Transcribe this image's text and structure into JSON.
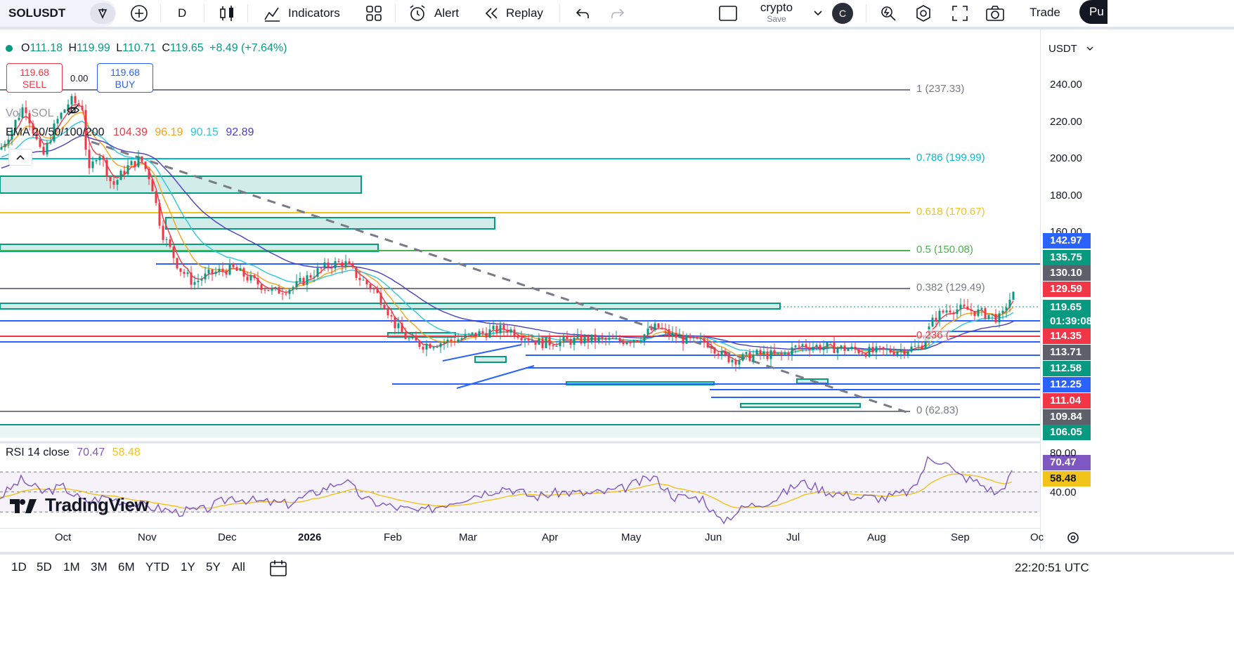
{
  "toolbar": {
    "symbol": "SOLUSDT",
    "interval": "D",
    "indicators_label": "Indicators",
    "alert_label": "Alert",
    "replay_label": "Replay",
    "layout_name": "crypto",
    "layout_save": "Save",
    "avatar_letter": "C",
    "trade_label": "Trade",
    "publish_label": "Pu"
  },
  "ohlc": {
    "open_label": "O",
    "open": "111.18",
    "high_label": "H",
    "high": "119.99",
    "low_label": "L",
    "low": "110.71",
    "close_label": "C",
    "close": "119.65",
    "change": "+8.49 (+7.64%)"
  },
  "trade_buttons": {
    "sell_price": "119.68",
    "sell_label": "SELL",
    "spread": "0.00",
    "buy_price": "119.68",
    "buy_label": "BUY"
  },
  "vol_label": "Vol · SOL",
  "ema": {
    "label": "EMA 20/50/100/200",
    "values": [
      "104.39",
      "96.19",
      "90.15",
      "92.89"
    ],
    "colors": [
      "#f23645",
      "#f7a21b",
      "#2ec7d6",
      "#4a3fbf"
    ]
  },
  "rsi": {
    "label": "RSI 14 close",
    "value": "70.47",
    "ma": "58.48",
    "levels": [
      "80.00",
      "40.00"
    ]
  },
  "currency": "USDT",
  "colors": {
    "up": "#089981",
    "down": "#f23645",
    "zone_fill": "#b2dfdb",
    "zone_border": "#089981",
    "blue_line": "#2962ff",
    "fib_gray": "#787b86",
    "fib_cyan": "#00bcd4",
    "fib_yellow": "#f2c31b",
    "fib_green": "#4caf50",
    "fib_red": "#f23645",
    "rsi_line": "#7e57c2",
    "rsi_ma": "#f2c31b"
  },
  "chart_data": {
    "type": "candlestick",
    "symbol": "SOLUSDT",
    "interval": "D",
    "x_ticks": [
      "Oct",
      "Nov",
      "Dec",
      "2026",
      "Feb",
      "Mar",
      "Apr",
      "May",
      "Jun",
      "Jul",
      "Aug",
      "Sep",
      "Oc"
    ],
    "y_ticks": [
      "240.00",
      "220.00",
      "200.00",
      "180.00",
      "160.00"
    ],
    "ylim": [
      100,
      248
    ],
    "fib_levels": [
      {
        "label": "1 (237.33)",
        "value": 237.33,
        "color": "#787b86"
      },
      {
        "label": "0.786 (199.99)",
        "value": 199.99,
        "color": "#00bcd4"
      },
      {
        "label": "0.618 (170.67)",
        "value": 170.67,
        "color": "#f2c31b"
      },
      {
        "label": "0.5 (150.08)",
        "value": 150.08,
        "color": "#4caf50"
      },
      {
        "label": "0.382 (129.49)",
        "value": 129.49,
        "color": "#787b86"
      },
      {
        "label": "0.236 (",
        "value": 114.35,
        "color": "#f23645"
      },
      {
        "label": "0 (62.83)",
        "value": 109.84,
        "color": "#787b86"
      }
    ],
    "price_tags": [
      {
        "value": "142.97",
        "color": "#2962ff"
      },
      {
        "value": "135.75",
        "color": "#089981"
      },
      {
        "value": "130.10",
        "color": "#5d606b"
      },
      {
        "value": "129.59",
        "color": "#f23645"
      },
      {
        "value": "119.65",
        "color": "#089981"
      },
      {
        "value": "01:39:08",
        "color": "#089981"
      },
      {
        "value": "114.35",
        "color": "#f23645"
      },
      {
        "value": "113.71",
        "color": "#5d606b"
      },
      {
        "value": "112.58",
        "color": "#089981"
      },
      {
        "value": "112.25",
        "color": "#2962ff"
      },
      {
        "value": "111.04",
        "color": "#f23645"
      },
      {
        "value": "109.84",
        "color": "#5d606b"
      },
      {
        "value": "106.05",
        "color": "#089981"
      }
    ],
    "rsi_tags": [
      {
        "value": "70.47",
        "color": "#7e57c2"
      },
      {
        "value": "58.48",
        "color": "#f2c31b"
      }
    ],
    "price_anchors": [
      [
        0,
        205
      ],
      [
        15,
        215
      ],
      [
        35,
        230
      ],
      [
        60,
        200
      ],
      [
        80,
        220
      ],
      [
        100,
        232
      ],
      [
        118,
        228
      ],
      [
        125,
        190
      ],
      [
        140,
        205
      ],
      [
        160,
        185
      ],
      [
        180,
        195
      ],
      [
        200,
        200
      ],
      [
        215,
        188
      ],
      [
        230,
        160
      ],
      [
        255,
        140
      ],
      [
        275,
        132
      ],
      [
        300,
        137
      ],
      [
        330,
        140
      ],
      [
        360,
        133
      ],
      [
        390,
        127
      ],
      [
        420,
        130
      ],
      [
        445,
        137
      ],
      [
        470,
        142
      ],
      [
        490,
        143
      ],
      [
        510,
        135
      ],
      [
        530,
        129
      ],
      [
        548,
        120
      ],
      [
        560,
        110
      ],
      [
        580,
        101
      ],
      [
        600,
        98
      ],
      [
        640,
        100
      ],
      [
        680,
        104
      ],
      [
        720,
        107
      ],
      [
        745,
        103
      ],
      [
        770,
        99
      ],
      [
        800,
        100
      ],
      [
        840,
        101
      ],
      [
        880,
        100
      ],
      [
        910,
        102
      ],
      [
        935,
        108
      ],
      [
        950,
        104
      ],
      [
        980,
        100
      ],
      [
        1010,
        99
      ],
      [
        1030,
        91
      ],
      [
        1050,
        90
      ],
      [
        1080,
        93
      ],
      [
        1110,
        92
      ],
      [
        1140,
        98
      ],
      [
        1170,
        97
      ],
      [
        1200,
        96
      ],
      [
        1240,
        94
      ],
      [
        1280,
        95
      ],
      [
        1310,
        97
      ],
      [
        1330,
        113
      ],
      [
        1350,
        118
      ],
      [
        1380,
        117
      ],
      [
        1410,
        114
      ],
      [
        1425,
        112
      ],
      [
        1432,
        120
      ],
      [
        1440,
        125
      ]
    ],
    "ema_series_names": [
      "EMA 20",
      "EMA 50",
      "EMA 100",
      "EMA 200"
    ],
    "rsi_anchors": [
      [
        0,
        45
      ],
      [
        30,
        62
      ],
      [
        60,
        50
      ],
      [
        90,
        55
      ],
      [
        120,
        40
      ],
      [
        150,
        45
      ],
      [
        190,
        38
      ],
      [
        215,
        35
      ],
      [
        250,
        30
      ],
      [
        290,
        32
      ],
      [
        330,
        45
      ],
      [
        370,
        40
      ],
      [
        410,
        38
      ],
      [
        450,
        50
      ],
      [
        490,
        62
      ],
      [
        520,
        42
      ],
      [
        560,
        35
      ],
      [
        600,
        30
      ],
      [
        640,
        40
      ],
      [
        680,
        48
      ],
      [
        720,
        55
      ],
      [
        760,
        45
      ],
      [
        800,
        50
      ],
      [
        840,
        48
      ],
      [
        880,
        52
      ],
      [
        930,
        65
      ],
      [
        960,
        45
      ],
      [
        1000,
        44
      ],
      [
        1025,
        20
      ],
      [
        1060,
        35
      ],
      [
        1100,
        42
      ],
      [
        1140,
        60
      ],
      [
        1180,
        50
      ],
      [
        1220,
        45
      ],
      [
        1260,
        44
      ],
      [
        1300,
        52
      ],
      [
        1320,
        82
      ],
      [
        1345,
        82
      ],
      [
        1360,
        68
      ],
      [
        1390,
        60
      ],
      [
        1420,
        48
      ],
      [
        1442,
        70
      ]
    ]
  },
  "time_axis_tail": "Oc",
  "range_buttons": [
    "1D",
    "5D",
    "1M",
    "3M",
    "6M",
    "YTD",
    "1Y",
    "5Y",
    "All"
  ],
  "clock": "22:20:51 UTC",
  "watermark": "TradingView"
}
